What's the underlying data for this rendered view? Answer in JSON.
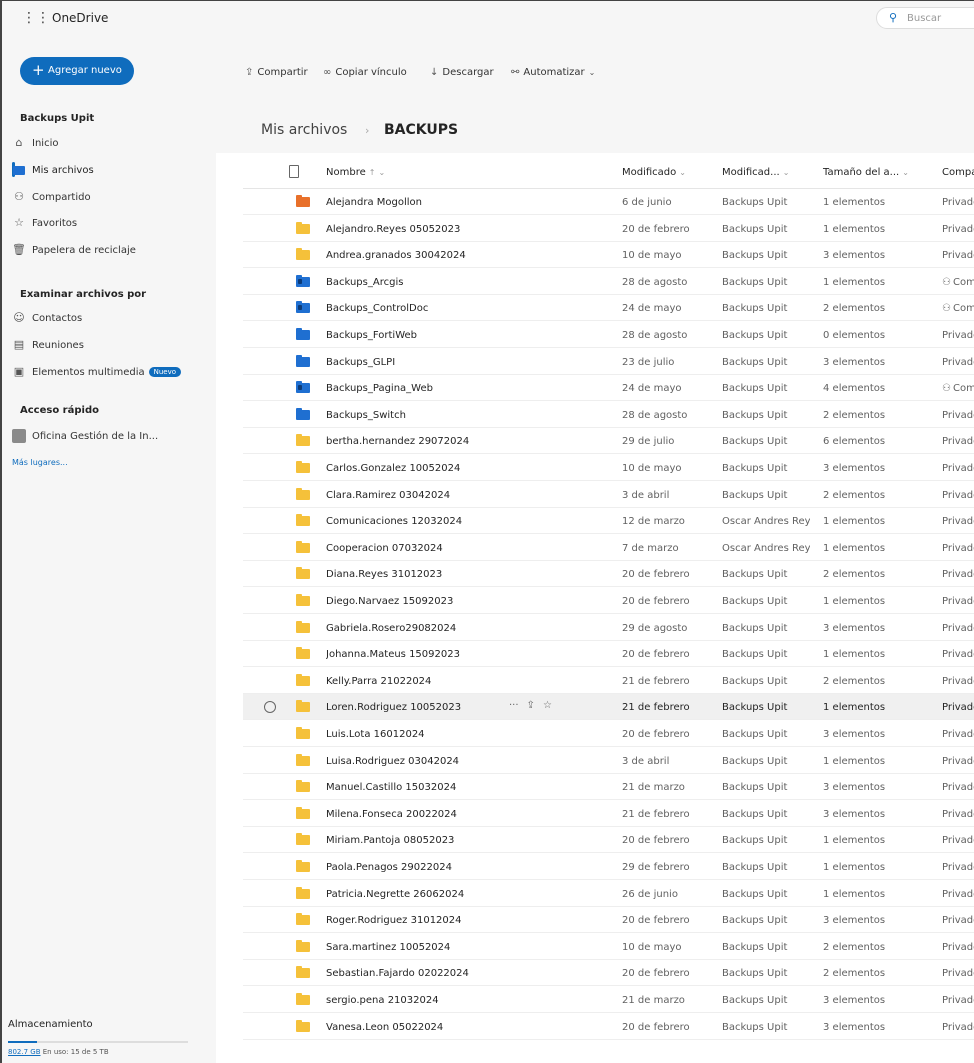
{
  "app": {
    "name": "OneDrive",
    "waffle_icon": "waffle-icon"
  },
  "search": {
    "placeholder": "Buscar"
  },
  "sidebar": {
    "new_button": "Agregar nuevo",
    "section_user": "Backups Upit",
    "items": [
      {
        "label": "Inicio",
        "icon": "home-icon"
      },
      {
        "label": "Mis archivos",
        "icon": "folder-icon",
        "active": true
      },
      {
        "label": "Compartido",
        "icon": "people-icon"
      },
      {
        "label": "Favoritos",
        "icon": "star-icon"
      },
      {
        "label": "Papelera de reciclaje",
        "icon": "trash-icon"
      }
    ],
    "browse_title": "Examinar archivos por",
    "browse": [
      {
        "label": "Contactos",
        "icon": "person-icon"
      },
      {
        "label": "Reuniones",
        "icon": "calendar-icon"
      },
      {
        "label": "Elementos multimedia",
        "icon": "image-icon",
        "badge": "Nuevo"
      }
    ],
    "quick_title": "Acceso rápido",
    "quick": [
      {
        "label": "Oficina Gestión de la In..."
      }
    ],
    "more_places": "Más lugares...",
    "storage_title": "Almacenamiento",
    "storage_used": "802.7 GB",
    "storage_text": "En uso: 15 de 5 TB",
    "storage_fraction": 0.16
  },
  "toolbar": {
    "share": "Compartir",
    "copy_link": "Copiar vínculo",
    "download": "Descargar",
    "automate": "Automatizar"
  },
  "breadcrumb": {
    "root": "Mis archivos",
    "current": "BACKUPS"
  },
  "columns": {
    "name": "Nombre",
    "name_sort": "↑",
    "modified": "Modificado",
    "modified_by": "Modificad...",
    "size": "Tamaño del a...",
    "sharing": "Compartir"
  },
  "files": [
    {
      "name": "Alejandra Mogollon",
      "modified": "6 de junio",
      "by": "Backups Upit",
      "size": "1 elementos",
      "share": "Privado",
      "color": "orange"
    },
    {
      "name": "Alejandro.Reyes 05052023",
      "modified": "20 de febrero",
      "by": "Backups Upit",
      "size": "1 elementos",
      "share": "Privado",
      "color": "yellow"
    },
    {
      "name": "Andrea.granados 30042024",
      "modified": "10 de mayo",
      "by": "Backups Upit",
      "size": "3 elementos",
      "share": "Privado",
      "color": "yellow"
    },
    {
      "name": "Backups_Arcgis",
      "modified": "28 de agosto",
      "by": "Backups Upit",
      "size": "1 elementos",
      "share": "Compartido",
      "color": "blue-shared"
    },
    {
      "name": "Backups_ControlDoc",
      "modified": "24 de mayo",
      "by": "Backups Upit",
      "size": "2 elementos",
      "share": "Compartido",
      "color": "blue-shared"
    },
    {
      "name": "Backups_FortiWeb",
      "modified": "28 de agosto",
      "by": "Backups Upit",
      "size": "0 elementos",
      "share": "Privado",
      "color": "blue"
    },
    {
      "name": "Backups_GLPI",
      "modified": "23 de julio",
      "by": "Backups Upit",
      "size": "3 elementos",
      "share": "Privado",
      "color": "blue"
    },
    {
      "name": "Backups_Pagina_Web",
      "modified": "24 de mayo",
      "by": "Backups Upit",
      "size": "4 elementos",
      "share": "Compartido",
      "color": "blue-shared"
    },
    {
      "name": "Backups_Switch",
      "modified": "28 de agosto",
      "by": "Backups Upit",
      "size": "2 elementos",
      "share": "Privado",
      "color": "blue"
    },
    {
      "name": "bertha.hernandez 29072024",
      "modified": "29 de julio",
      "by": "Backups Upit",
      "size": "6 elementos",
      "share": "Privado",
      "color": "yellow"
    },
    {
      "name": "Carlos.Gonzalez 10052024",
      "modified": "10 de mayo",
      "by": "Backups Upit",
      "size": "3 elementos",
      "share": "Privado",
      "color": "yellow"
    },
    {
      "name": "Clara.Ramirez 03042024",
      "modified": "3 de abril",
      "by": "Backups Upit",
      "size": "2 elementos",
      "share": "Privado",
      "color": "yellow"
    },
    {
      "name": "Comunicaciones 12032024",
      "modified": "12 de marzo",
      "by": "Oscar Andres Reye",
      "size": "1 elementos",
      "share": "Privado",
      "color": "yellow"
    },
    {
      "name": "Cooperacion 07032024",
      "modified": "7 de marzo",
      "by": "Oscar Andres Reye",
      "size": "1 elementos",
      "share": "Privado",
      "color": "yellow"
    },
    {
      "name": "Diana.Reyes 31012023",
      "modified": "20 de febrero",
      "by": "Backups Upit",
      "size": "2 elementos",
      "share": "Privado",
      "color": "yellow"
    },
    {
      "name": "Diego.Narvaez 15092023",
      "modified": "20 de febrero",
      "by": "Backups Upit",
      "size": "1 elementos",
      "share": "Privado",
      "color": "yellow"
    },
    {
      "name": "Gabriela.Rosero29082024",
      "modified": "29 de agosto",
      "by": "Backups Upit",
      "size": "3 elementos",
      "share": "Privado",
      "color": "yellow"
    },
    {
      "name": "Johanna.Mateus 15092023",
      "modified": "20 de febrero",
      "by": "Backups Upit",
      "size": "1 elementos",
      "share": "Privado",
      "color": "yellow"
    },
    {
      "name": "Kelly.Parra 21022024",
      "modified": "21 de febrero",
      "by": "Backups Upit",
      "size": "2 elementos",
      "share": "Privado",
      "color": "yellow"
    },
    {
      "name": "Loren.Rodriguez 10052023",
      "modified": "21 de febrero",
      "by": "Backups Upit",
      "size": "1 elementos",
      "share": "Privado",
      "color": "yellow",
      "hover": true
    },
    {
      "name": "Luis.Lota 16012024",
      "modified": "20 de febrero",
      "by": "Backups Upit",
      "size": "3 elementos",
      "share": "Privado",
      "color": "yellow"
    },
    {
      "name": "Luisa.Rodriguez 03042024",
      "modified": "3 de abril",
      "by": "Backups Upit",
      "size": "1 elementos",
      "share": "Privado",
      "color": "yellow"
    },
    {
      "name": "Manuel.Castillo 15032024",
      "modified": "21 de marzo",
      "by": "Backups Upit",
      "size": "3 elementos",
      "share": "Privado",
      "color": "yellow"
    },
    {
      "name": "Milena.Fonseca 20022024",
      "modified": "21 de febrero",
      "by": "Backups Upit",
      "size": "3 elementos",
      "share": "Privado",
      "color": "yellow"
    },
    {
      "name": "Miriam.Pantoja 08052023",
      "modified": "20 de febrero",
      "by": "Backups Upit",
      "size": "1 elementos",
      "share": "Privado",
      "color": "yellow"
    },
    {
      "name": "Paola.Penagos 29022024",
      "modified": "29 de febrero",
      "by": "Backups Upit",
      "size": "1 elementos",
      "share": "Privado",
      "color": "yellow"
    },
    {
      "name": "Patricia.Negrette 26062024",
      "modified": "26 de junio",
      "by": "Backups Upit",
      "size": "1 elementos",
      "share": "Privado",
      "color": "yellow"
    },
    {
      "name": "Roger.Rodriguez 31012024",
      "modified": "20 de febrero",
      "by": "Backups Upit",
      "size": "3 elementos",
      "share": "Privado",
      "color": "yellow"
    },
    {
      "name": "Sara.martinez 10052024",
      "modified": "10 de mayo",
      "by": "Backups Upit",
      "size": "2 elementos",
      "share": "Privado",
      "color": "yellow"
    },
    {
      "name": "Sebastian.Fajardo 02022024",
      "modified": "20 de febrero",
      "by": "Backups Upit",
      "size": "2 elementos",
      "share": "Privado",
      "color": "yellow"
    },
    {
      "name": "sergio.pena 21032024",
      "modified": "21 de marzo",
      "by": "Backups Upit",
      "size": "3 elementos",
      "share": "Privado",
      "color": "yellow"
    },
    {
      "name": "Vanesa.Leon 05022024",
      "modified": "20 de febrero",
      "by": "Backups Upit",
      "size": "3 elementos",
      "share": "Privado",
      "color": "yellow"
    }
  ],
  "colors": {
    "accent": "#0f6cbd",
    "folder_yellow": "#f5c13a",
    "folder_blue": "#1f6fd1",
    "folder_orange": "#e8702a"
  }
}
